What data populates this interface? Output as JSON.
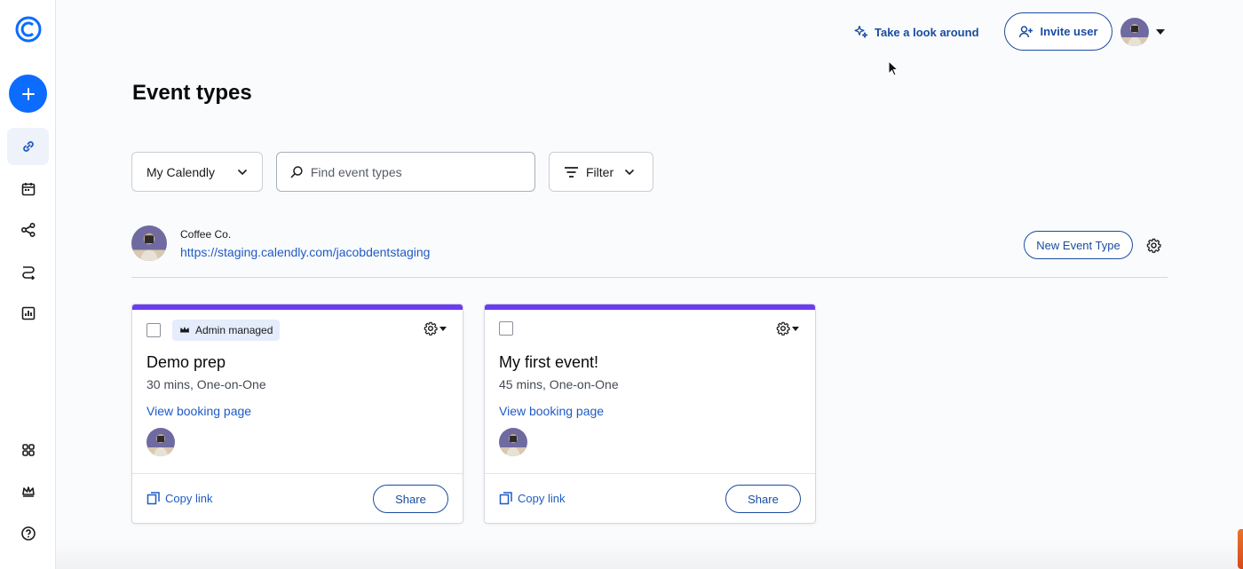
{
  "sidebar": {
    "logo": "calendly-logo-icon",
    "create_icon": "plus-icon",
    "nav_items": [
      {
        "name": "scheduling",
        "icon": "link-icon",
        "active": true
      },
      {
        "name": "meetings",
        "icon": "calendar-icon",
        "active": false
      },
      {
        "name": "workflows",
        "icon": "workflow-icon",
        "active": false
      },
      {
        "name": "routing",
        "icon": "routing-icon",
        "active": false
      },
      {
        "name": "analytics",
        "icon": "chart-icon",
        "active": false
      },
      {
        "name": "integrations",
        "icon": "apps-grid-icon",
        "active": false
      },
      {
        "name": "admin",
        "icon": "crown-icon",
        "active": false
      },
      {
        "name": "help",
        "icon": "help-icon",
        "active": false
      }
    ]
  },
  "header": {
    "take_look_label": "Take a look around",
    "invite_label": "Invite user"
  },
  "page": {
    "title": "Event types"
  },
  "toolbar": {
    "calendar_select": "My Calendly",
    "search_placeholder": "Find event types",
    "filter_label": "Filter"
  },
  "org": {
    "name": "Coffee Co.",
    "url": "https://staging.calendly.com/jacobdentstaging",
    "new_event_label": "New Event Type"
  },
  "cards": [
    {
      "badge": "Admin managed",
      "title": "Demo prep",
      "subtitle": "30 mins, One-on-One",
      "link": "View booking page",
      "copy_label": "Copy link",
      "share_label": "Share"
    },
    {
      "badge": "",
      "title": "My first event!",
      "subtitle": "45 mins, One-on-One",
      "link": "View booking page",
      "copy_label": "Copy link",
      "share_label": "Share"
    }
  ],
  "colors": {
    "primary": "#0b6cff",
    "link": "#1f5bc4",
    "outline": "#1a4ca0",
    "card_accent": "#6b3cf0",
    "badge_bg": "#e5ecfb"
  }
}
